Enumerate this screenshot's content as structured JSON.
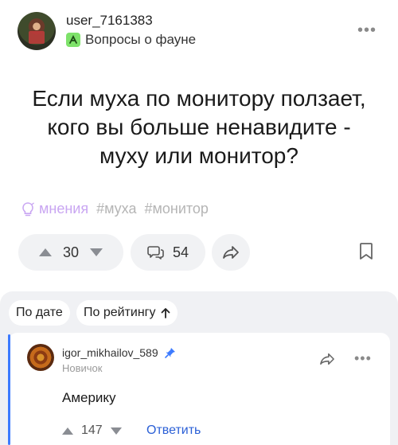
{
  "post": {
    "author": "user_7161383",
    "community": "Вопросы о фауне",
    "title_line1": "Если муха по монитору ползает,",
    "title_line2": "кого вы больше ненавидите -",
    "title_line3": "муху или монитор?",
    "tag_opinions": "мнения",
    "tags": [
      "#муха",
      "#монитор"
    ],
    "rating": "30",
    "comments_count": "54"
  },
  "sort": {
    "by_date": "По дате",
    "by_rating": "По рейтингу"
  },
  "comment": {
    "author": "igor_mikhailov_589",
    "rank": "Новичок",
    "text": "Америку",
    "rating": "147",
    "reply_label": "Ответить"
  },
  "colors": {
    "accent_blue": "#2a5fd6",
    "thread_line": "#3d7bff",
    "community_badge": "#7ee26a",
    "opinions_purple": "#c9a6f2"
  },
  "icons": {
    "more": "more-icon",
    "share": "share-icon",
    "bookmark": "bookmark-icon",
    "comments": "comments-icon",
    "pin": "pin-icon",
    "upvote": "upvote-icon",
    "downvote": "downvote-icon"
  }
}
